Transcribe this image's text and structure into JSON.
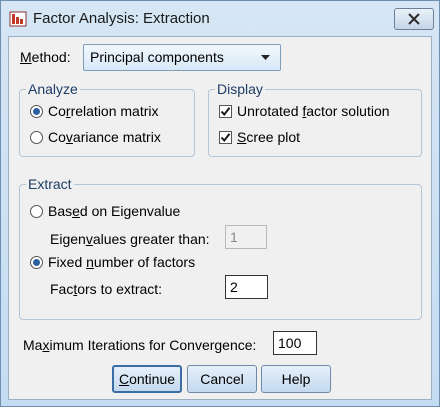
{
  "window": {
    "title": "Factor Analysis: Extraction"
  },
  "method": {
    "label_prefix": "",
    "label_m": "M",
    "label_rest": "ethod:",
    "selected": "Principal components"
  },
  "analyze": {
    "legend": "Analyze",
    "options": [
      {
        "pre": "Co",
        "u": "r",
        "post": "relation matrix",
        "selected": true
      },
      {
        "pre": "Co",
        "u": "v",
        "post": "ariance matrix",
        "selected": false
      }
    ]
  },
  "display": {
    "legend": "Display",
    "options": [
      {
        "pre": "Unrotated ",
        "u": "f",
        "post": "actor solution",
        "checked": true
      },
      {
        "pre": "",
        "u": "S",
        "post": "cree plot",
        "checked": true
      }
    ]
  },
  "extract": {
    "legend": "Extract",
    "eigen_option": {
      "pre": "Bas",
      "u": "e",
      "post": "d on Eigenvalue",
      "selected": false
    },
    "eigen_label": {
      "pre": "Eigen",
      "u": "v",
      "post": "alues greater than:"
    },
    "eigen_value": "1",
    "fixed_option": {
      "pre": "Fixed ",
      "u": "n",
      "post": "umber of factors",
      "selected": true
    },
    "factors_label": {
      "pre": "Fac",
      "u": "t",
      "post": "ors to extract:"
    },
    "factors_value": "2"
  },
  "max_iterations": {
    "pre": "Ma",
    "u": "x",
    "post": "imum Iterations for Convergence:",
    "value": "100"
  },
  "buttons": {
    "continue": {
      "pre": "",
      "u": "C",
      "post": "ontinue"
    },
    "cancel": "Cancel",
    "help": "Help"
  },
  "colors": {
    "legend_text": "#1d3c66",
    "radio_dot": "#2c5f9e",
    "window_chrome": "#c9dff2"
  }
}
